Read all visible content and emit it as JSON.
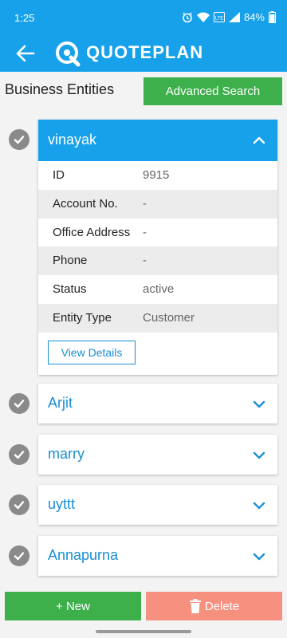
{
  "status_bar": {
    "time": "1:25",
    "battery": "84%",
    "icons": [
      "alarm-icon",
      "wifi-icon",
      "volte-icon",
      "signal-icon",
      "battery-icon"
    ]
  },
  "app_bar": {
    "brand": "QUOTEPLAN",
    "back_icon": "arrow-left-icon",
    "logo_icon": "quoteplan-logo-icon"
  },
  "header": {
    "title": "Business Entities",
    "advanced_search_label": "Advanced Search"
  },
  "entities": [
    {
      "name": "vinayak",
      "expanded": true,
      "details": [
        {
          "label": "ID",
          "value": "9915"
        },
        {
          "label": "Account No.",
          "value": "-"
        },
        {
          "label": "Office Address",
          "value": "-"
        },
        {
          "label": "Phone",
          "value": "-"
        },
        {
          "label": "Status",
          "value": "active"
        },
        {
          "label": "Entity Type",
          "value": "Customer"
        }
      ],
      "view_details_label": "View Details"
    },
    {
      "name": "Arjit",
      "expanded": false
    },
    {
      "name": "marry",
      "expanded": false
    },
    {
      "name": "uyttt",
      "expanded": false
    },
    {
      "name": "Annapurna",
      "expanded": false
    }
  ],
  "footer": {
    "new_label": "+ New",
    "delete_label": "Delete"
  },
  "colors": {
    "primary": "#16a1ea",
    "green": "#3db04c",
    "delete": "#f6907f",
    "link": "#1a8fd2"
  }
}
